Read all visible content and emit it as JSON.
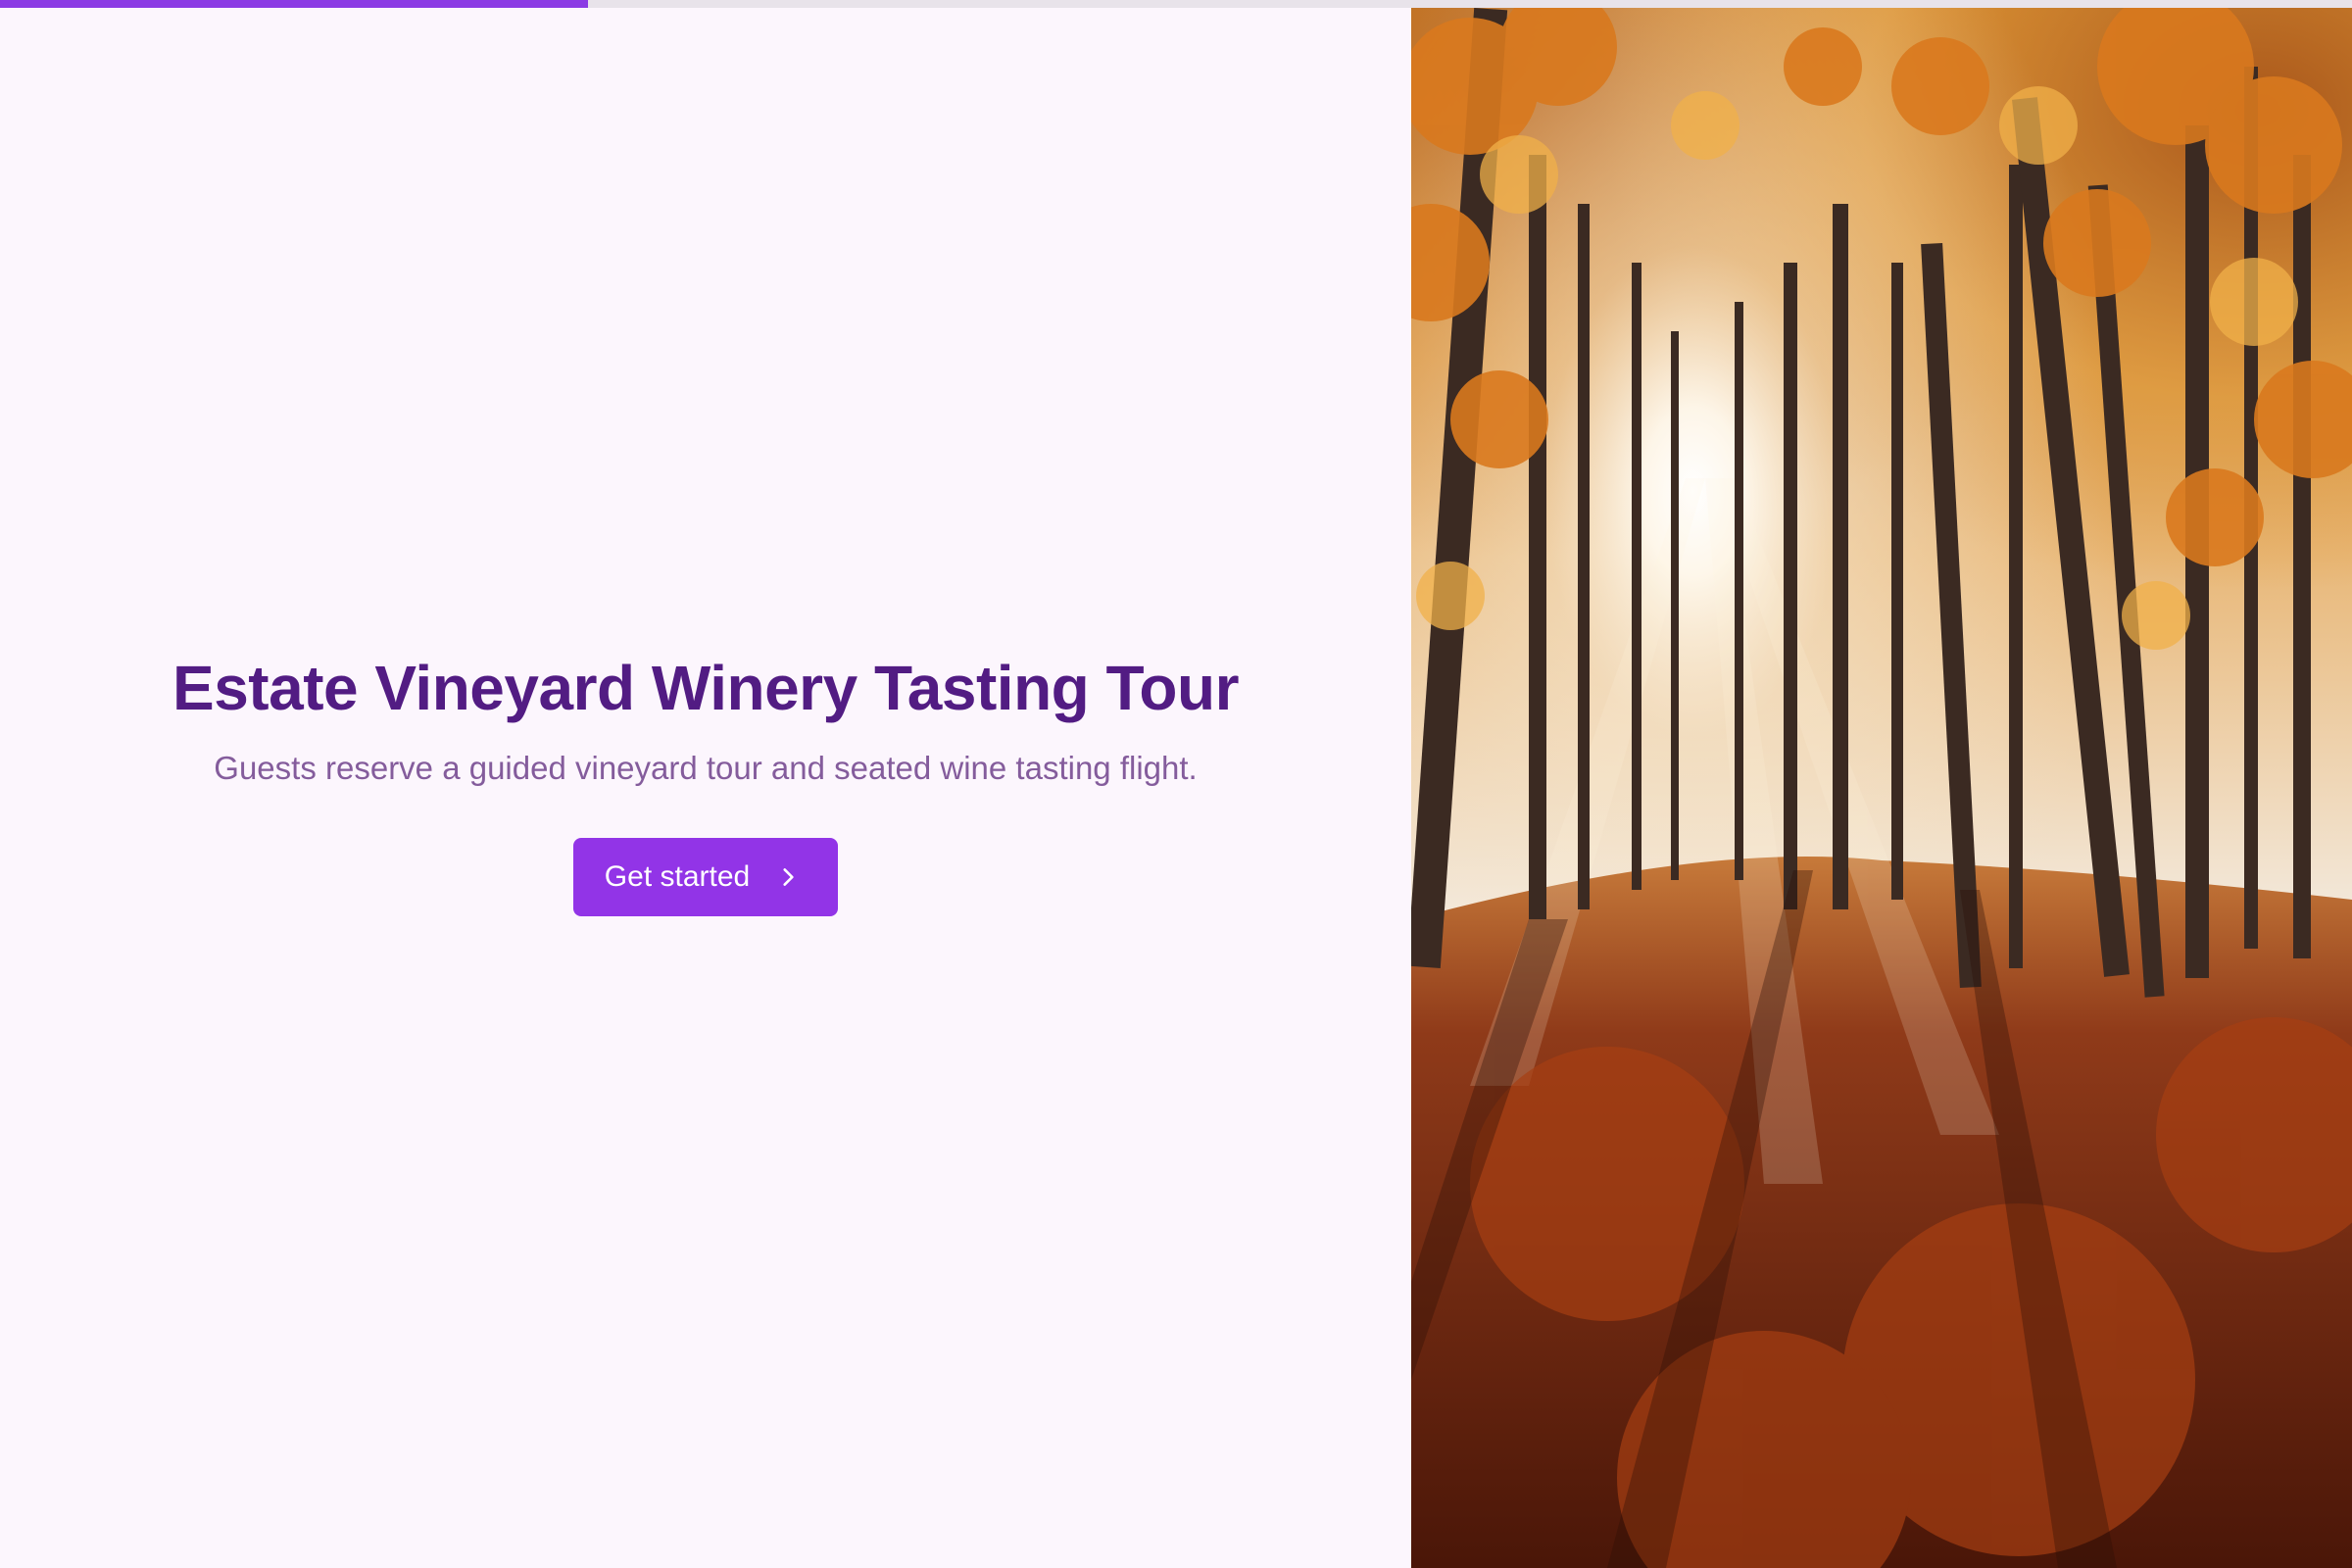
{
  "progress": {
    "fraction": 0.25,
    "color": "#8b3be4"
  },
  "hero": {
    "title": "Estate Vineyard Winery Tasting Tour",
    "subtitle": "Guests reserve a guided vineyard tour and seated wine tasting flight.",
    "cta_label": "Get started",
    "cta_icon": "chevron-right-icon"
  },
  "colors": {
    "background": "#fcf6fd",
    "title": "#521c83",
    "subtitle": "#845c9c",
    "accent": "#9234e7"
  },
  "image": {
    "subject": "sunlit autumn forest with orange foliage and fallen leaves"
  }
}
